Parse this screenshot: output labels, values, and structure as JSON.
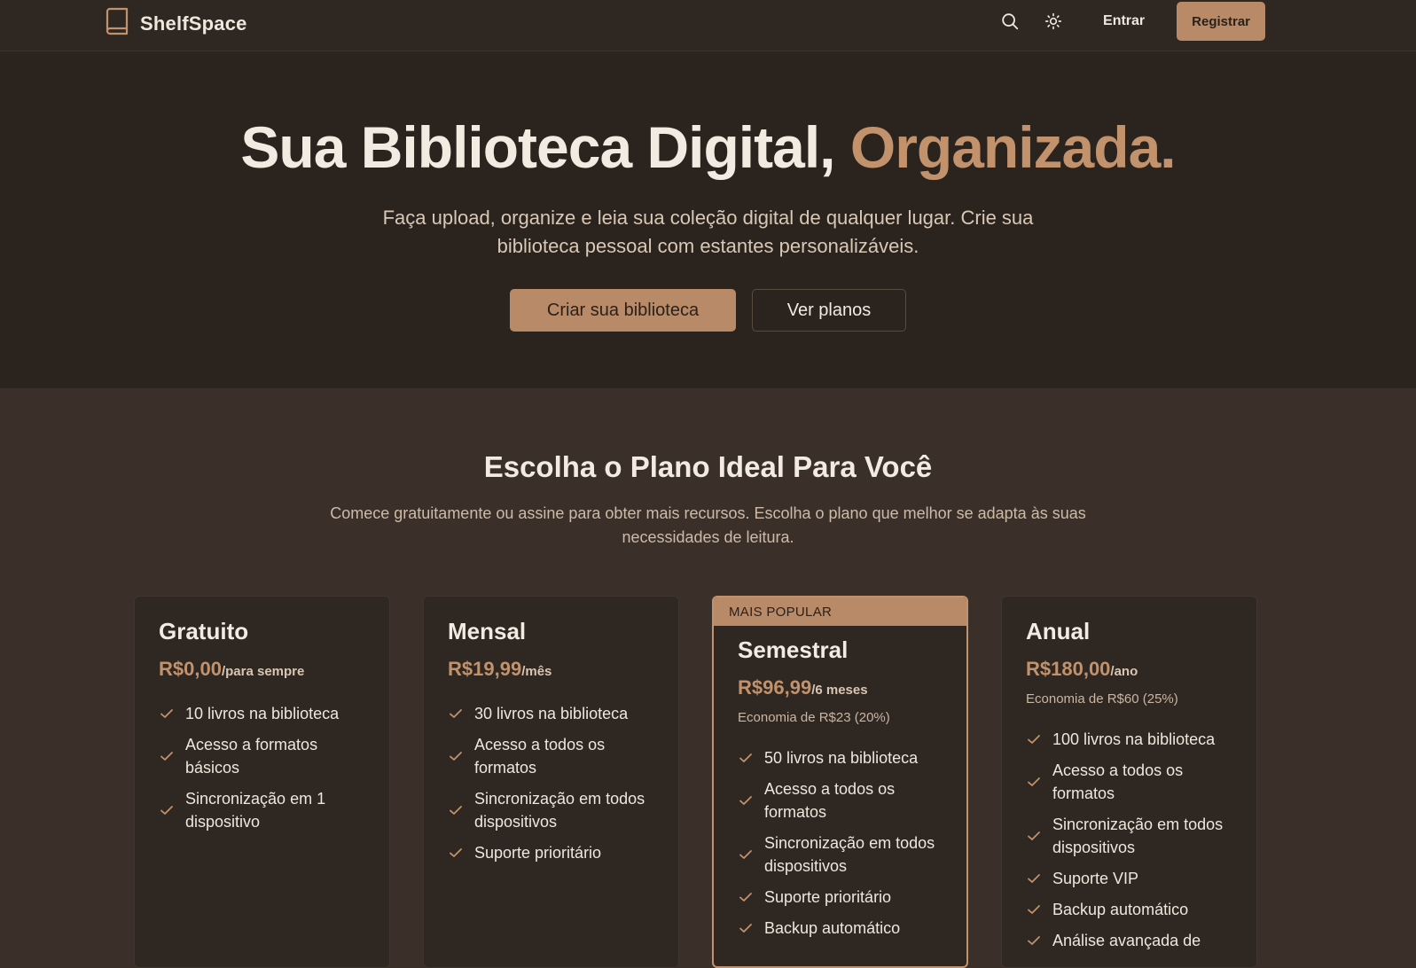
{
  "nav": {
    "brand": "ShelfSpace",
    "login_label": "Entrar",
    "register_label": "Registrar",
    "icons": [
      "book-icon",
      "search-icon",
      "sun-icon"
    ]
  },
  "hero": {
    "title_main": "Sua Biblioteca Digital,",
    "title_accent": "Organizada.",
    "subtitle": "Faça upload, organize e leia sua coleção digital de qualquer lugar. Crie sua biblioteca pessoal com estantes personalizáveis.",
    "primary_cta": "Criar sua biblioteca",
    "secondary_cta": "Ver planos"
  },
  "pricing": {
    "title": "Escolha o Plano Ideal Para Você",
    "subtitle": "Comece gratuitamente ou assine para obter mais recursos. Escolha o plano que melhor se adapta às suas necessidades de leitura.",
    "plans": [
      {
        "name": "Gratuito",
        "price": "R$0,00",
        "period": "/para sempre",
        "saving": "",
        "features": [
          "10 livros na biblioteca",
          "Acesso a formatos básicos",
          "Sincronização em 1 dispositivo"
        ]
      },
      {
        "name": "Mensal",
        "price": "R$19,99",
        "period": "/mês",
        "saving": "",
        "features": [
          "30 livros na biblioteca",
          "Acesso a todos os formatos",
          "Sincronização em todos dispositivos",
          "Suporte prioritário"
        ]
      },
      {
        "name": "Semestral",
        "badge": "MAIS POPULAR",
        "price": "R$96,99",
        "period": "/6 meses",
        "saving": "Economia de R$23 (20%)",
        "features": [
          "50 livros na biblioteca",
          "Acesso a todos os formatos",
          "Sincronização em todos dispositivos",
          "Suporte prioritário",
          "Backup automático"
        ]
      },
      {
        "name": "Anual",
        "price": "R$180,00",
        "period": "/ano",
        "saving": "Economia de R$60 (25%)",
        "features": [
          "100 livros na biblioteca",
          "Acesso a todos os formatos",
          "Sincronização em todos dispositivos",
          "Suporte VIP",
          "Backup automático",
          "Análise avançada de"
        ]
      }
    ]
  },
  "colors": {
    "accent": "#c1926c",
    "button": "#b98a67",
    "hero_bg": "#2b231d",
    "section_bg": "#3a3029",
    "card_bg": "#2f2721"
  }
}
